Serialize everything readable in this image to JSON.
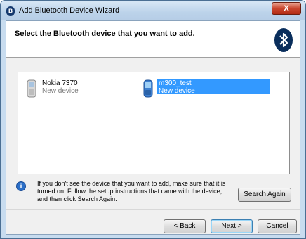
{
  "window": {
    "title": "Add Bluetooth Device Wizard",
    "close_label": "X"
  },
  "header": {
    "title": "Select the Bluetooth device that you want to add."
  },
  "devices": [
    {
      "name": "Nokia 7370",
      "status": "New device",
      "selected": false
    },
    {
      "name": "m300_test",
      "status": "New device",
      "selected": true
    }
  ],
  "info": {
    "text": "If you don't see the device that you want to add, make sure that it is turned on. Follow the setup instructions that came with the device, and then click Search Again."
  },
  "buttons": {
    "search_again": "Search Again",
    "back": "< Back",
    "next": "Next >",
    "cancel": "Cancel"
  },
  "colors": {
    "selection": "#3399ff",
    "bluetooth_logo": "#0a2e5c"
  },
  "icons": {
    "title": "bluetooth-icon",
    "header": "bluetooth-logo-icon",
    "device_1": "phone-icon",
    "device_2": "phone-icon",
    "info": "info-icon"
  }
}
